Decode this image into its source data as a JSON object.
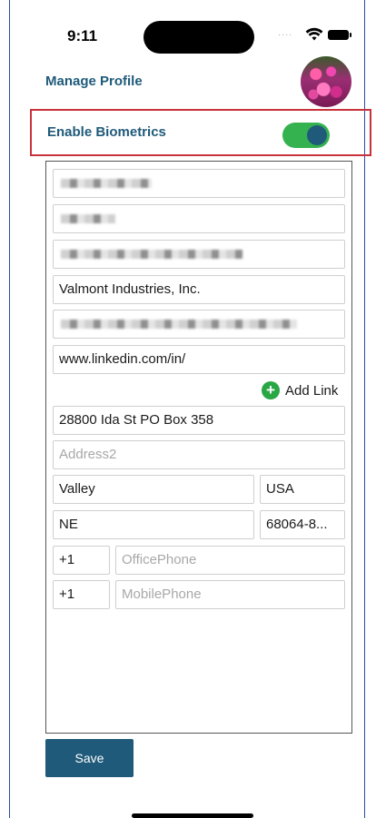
{
  "status_bar": {
    "time": "9:11",
    "signal": "....",
    "icons": [
      "wifi-icon",
      "battery-icon"
    ]
  },
  "header": {
    "title": "Manage Profile",
    "avatar": "avatar-photo"
  },
  "biometrics": {
    "label": "Enable Biometrics",
    "enabled": true,
    "toggle_color": "#33b24f",
    "knob_color": "#1f5a7a"
  },
  "form": {
    "company": "Valmont Industries, Inc.",
    "linkedin": "www.linkedin.com/in/",
    "add_link_label": "Add Link",
    "address1": "28800 Ida St PO Box 358",
    "address2_placeholder": "Address2",
    "city": "Valley",
    "country": "USA",
    "state": "NE",
    "zip": "68064-8...",
    "office_phone_code": "+1",
    "office_phone_placeholder": "OfficePhone",
    "mobile_phone_code": "+1",
    "mobile_phone_placeholder": "MobilePhone"
  },
  "actions": {
    "save_label": "Save"
  },
  "colors": {
    "brand": "#1f5a7a",
    "accent_green": "#2aa745",
    "highlight_border": "#c8323b"
  }
}
